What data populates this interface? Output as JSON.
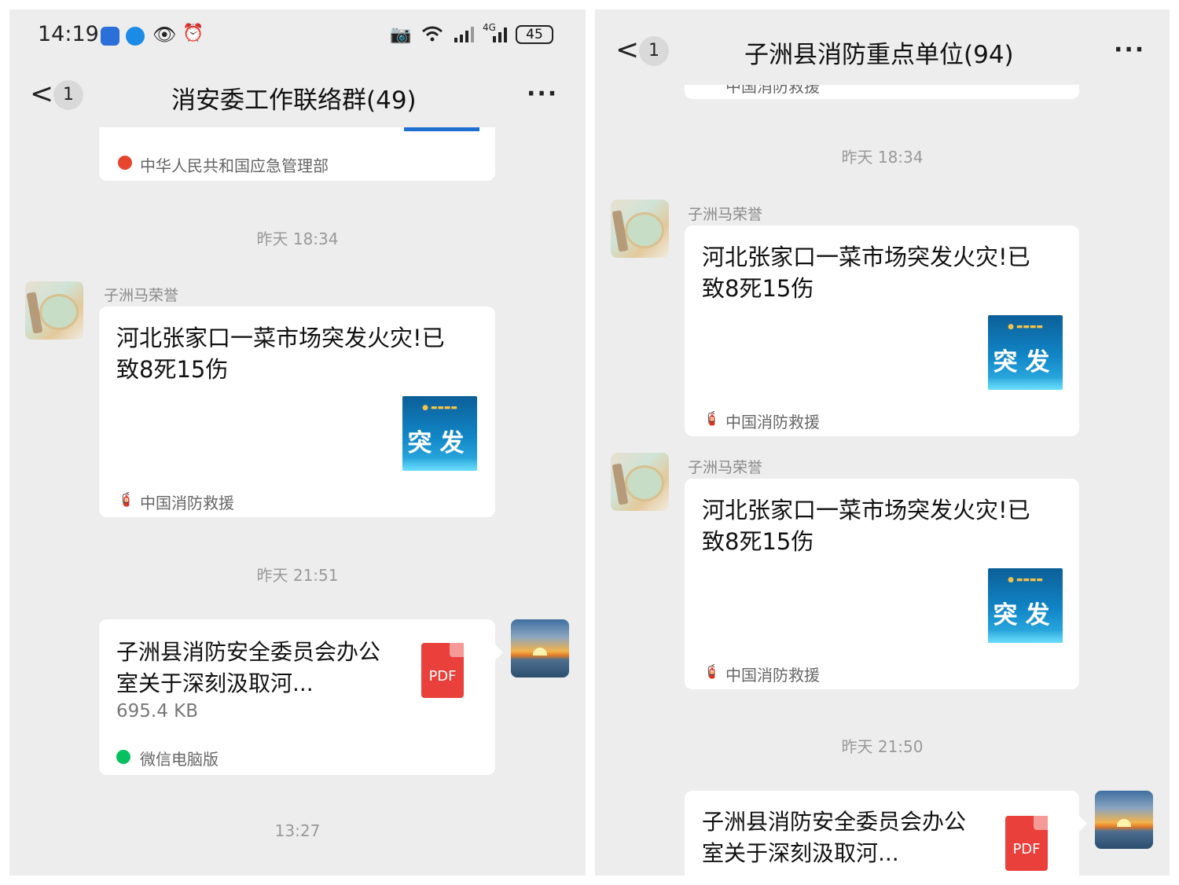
{
  "left": {
    "status_time": "14:19",
    "status_battery": "45",
    "status_network": "4G",
    "back_badge": "1",
    "title": "消安委工作联络群(49)",
    "more": "···",
    "top_card_source": "中华人民共和国应急管理部",
    "time1": "昨天 18:34",
    "sender": "子洲马荣誉",
    "article_title": "河北张家口一菜市场突发火灾!已致8死15伤",
    "article_thumb_text": "突发",
    "article_source": "中国消防救援",
    "time2": "昨天 21:51",
    "file_title": "子洲县消防安全委员会办公室关于深刻汲取河...",
    "file_size": "695.4 KB",
    "file_icon_label": "PDF",
    "file_source": "微信电脑版",
    "time3": "13:27"
  },
  "right": {
    "back_badge": "1",
    "title": "子洲县消防重点单位(94)",
    "more": "···",
    "top_card_source": "中国消防救援",
    "time1": "昨天 18:34",
    "sender1": "子洲马荣誉",
    "article1_title": "河北张家口一菜市场突发火灾!已致8死15伤",
    "article1_thumb_text": "突发",
    "article1_source": "中国消防救援",
    "sender2": "子洲马荣誉",
    "article2_title": "河北张家口一菜市场突发火灾!已致8死15伤",
    "article2_thumb_text": "突发",
    "article2_source": "中国消防救援",
    "time2": "昨天 21:50",
    "file_title": "子洲县消防安全委员会办公室关于深刻汲取河...",
    "file_icon_label": "PDF"
  },
  "colors": {
    "chat_bg": "#ededed",
    "card_bg": "#ffffff",
    "pdf_red": "#e9403b",
    "thumb_blue": "#1186c7",
    "wechat_green": "#07c160"
  }
}
